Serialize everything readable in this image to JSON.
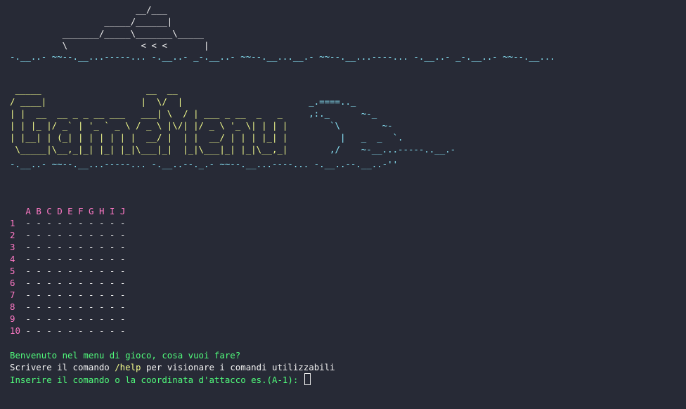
{
  "terminal": {
    "ship_art": [
      "                        __/___",
      "                  _____/______|",
      "          _______/_____\\_______\\_____",
      "          \\              < < <       |"
    ],
    "wave_top": "-.__..- ~~--.__...-----... -.__..- _-.__..- ~~--.__...__.- ~~--.__...----... -.__..- _-.__..- ~~--.__...",
    "title_art": [
      [
        " _____                    __  __",
        "                                        "
      ],
      [
        "/ ____|                  |  \\/  |",
        "                        _.====.._       "
      ],
      [
        "| |  __  __ _ _ __ ___   ___| \\  / | ___ _ __  _   _",
        "     ,:._      ~-_    "
      ],
      [
        "| | |_ |/ _` | '_ ` _ \\ / _ \\ |\\/| |/ _ \\ '_ \\| | | |",
        "        `\\        ~- "
      ],
      [
        "| |__| | (_| | | | | | |  __/ |  | |  __/ | | | |_| |",
        "          |   _  _  `.  "
      ],
      [
        " \\_____|\\__,_|_| |_| |_|\\___|_|  |_|\\___|_| |_|\\__,_|",
        "        ,/    ~-__...-----..__.-"
      ]
    ],
    "wave_bottom": "-.__..- ~~--.__...-----... -.__..--._.- ~~--.__...----... -.__..--.__..-''",
    "grid": {
      "columns": [
        "A",
        "B",
        "C",
        "D",
        "E",
        "F",
        "G",
        "H",
        "I",
        "J"
      ],
      "rows": [
        {
          "label": "1",
          "cells": [
            "-",
            "-",
            "-",
            "-",
            "-",
            "-",
            "-",
            "-",
            "-",
            "-"
          ]
        },
        {
          "label": "2",
          "cells": [
            "-",
            "-",
            "-",
            "-",
            "-",
            "-",
            "-",
            "-",
            "-",
            "-"
          ]
        },
        {
          "label": "3",
          "cells": [
            "-",
            "-",
            "-",
            "-",
            "-",
            "-",
            "-",
            "-",
            "-",
            "-"
          ]
        },
        {
          "label": "4",
          "cells": [
            "-",
            "-",
            "-",
            "-",
            "-",
            "-",
            "-",
            "-",
            "-",
            "-"
          ]
        },
        {
          "label": "5",
          "cells": [
            "-",
            "-",
            "-",
            "-",
            "-",
            "-",
            "-",
            "-",
            "-",
            "-"
          ]
        },
        {
          "label": "6",
          "cells": [
            "-",
            "-",
            "-",
            "-",
            "-",
            "-",
            "-",
            "-",
            "-",
            "-"
          ]
        },
        {
          "label": "7",
          "cells": [
            "-",
            "-",
            "-",
            "-",
            "-",
            "-",
            "-",
            "-",
            "-",
            "-"
          ]
        },
        {
          "label": "8",
          "cells": [
            "-",
            "-",
            "-",
            "-",
            "-",
            "-",
            "-",
            "-",
            "-",
            "-"
          ]
        },
        {
          "label": "9",
          "cells": [
            "-",
            "-",
            "-",
            "-",
            "-",
            "-",
            "-",
            "-",
            "-",
            "-"
          ]
        },
        {
          "label": "10",
          "cells": [
            "-",
            "-",
            "-",
            "-",
            "-",
            "-",
            "-",
            "-",
            "-",
            "-"
          ]
        }
      ]
    },
    "messages": {
      "welcome": "Benvenuto nel menu di gioco, cosa vuoi fare?",
      "help_prefix": "Scrivere il comando ",
      "help_command": "/help",
      "help_suffix": " per visionare i comandi utilizzabili",
      "prompt": "Inserire il comando o la coordinata d'attacco es.(A-1): "
    },
    "colors": {
      "background": "#272a36",
      "title": "#f1fa8c",
      "wave": "#8be9fd",
      "grid_labels": "#ff79c6",
      "message_green": "#50fa7b",
      "text": "#f1f1f1"
    }
  }
}
